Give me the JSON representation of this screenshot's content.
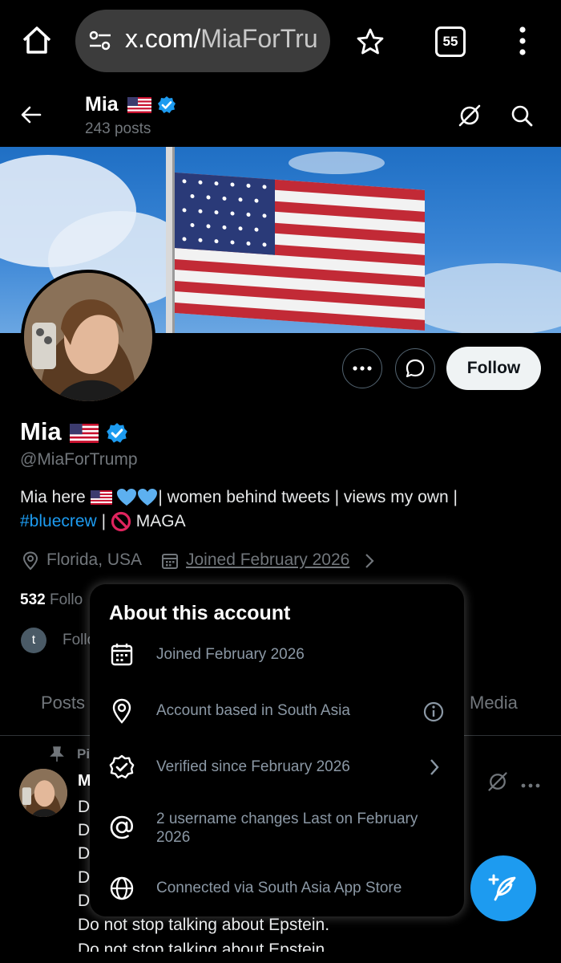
{
  "browser": {
    "url_host": "x.com/",
    "url_path": "MiaForTrump",
    "tab_count": "55"
  },
  "header": {
    "name": "Mia",
    "posts_count": "243 posts"
  },
  "profile": {
    "display_name": "Mia",
    "handle": "@MiaForTrump",
    "bio_line1_a": "Mia here",
    "bio_line1_b": "| women behind tweets | views my own |",
    "bio_hashtag": "#bluecrew",
    "bio_sep": "|",
    "bio_line2_end": "MAGA",
    "location": "Florida, USA",
    "joined": "Joined February 2026",
    "follow_label": "Follow",
    "following_count": "532",
    "following_label_partial": "Follo",
    "followed_by_partial": "Follo",
    "followed_by_avatar_letter": "t"
  },
  "tabs": {
    "posts": "Posts",
    "media": "Media"
  },
  "popup": {
    "title": "About this account",
    "rows": [
      {
        "icon": "calendar-icon",
        "text": "Joined February 2026"
      },
      {
        "icon": "location-pin-icon",
        "text": "Account based in South Asia"
      },
      {
        "icon": "verified-badge-icon",
        "text": "Verified since February 2026"
      },
      {
        "icon": "at-sign-icon",
        "text": "2 username changes Last on February 2026"
      },
      {
        "icon": "globe-icon",
        "text": "Connected via South Asia App Store"
      }
    ]
  },
  "tweet": {
    "pinned_partial": "Pi",
    "name_partial": "M",
    "line_initial": "D",
    "full_line": "Do not stop talking about Epstein."
  },
  "colors": {
    "accent": "#1d9bf0",
    "background": "#000000",
    "muted": "#71767b"
  }
}
